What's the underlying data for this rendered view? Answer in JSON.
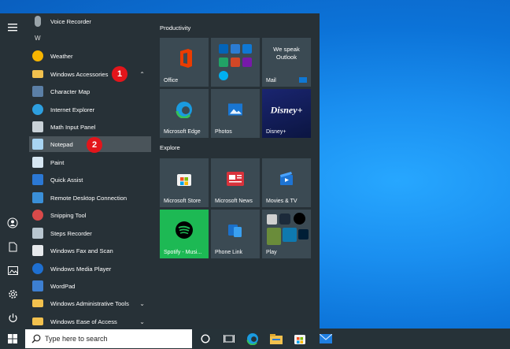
{
  "app_list": {
    "section_letter": "W",
    "items": [
      {
        "label": "Voice Recorder",
        "icon": "microphone-icon"
      },
      {
        "label": "Weather",
        "icon": "weather-icon"
      },
      {
        "label": "Windows Accessories",
        "icon": "folder-icon"
      },
      {
        "label": "Character Map",
        "icon": "character-map-icon"
      },
      {
        "label": "Internet Explorer",
        "icon": "internet-explorer-icon"
      },
      {
        "label": "Math Input Panel",
        "icon": "math-input-icon"
      },
      {
        "label": "Notepad",
        "icon": "notepad-icon"
      },
      {
        "label": "Paint",
        "icon": "paint-icon"
      },
      {
        "label": "Quick Assist",
        "icon": "quick-assist-icon"
      },
      {
        "label": "Remote Desktop Connection",
        "icon": "remote-desktop-icon"
      },
      {
        "label": "Snipping Tool",
        "icon": "snipping-tool-icon"
      },
      {
        "label": "Steps Recorder",
        "icon": "steps-recorder-icon"
      },
      {
        "label": "Windows Fax and Scan",
        "icon": "fax-scan-icon"
      },
      {
        "label": "Windows Media Player",
        "icon": "media-player-icon"
      },
      {
        "label": "WordPad",
        "icon": "wordpad-icon"
      },
      {
        "label": "Windows Administrative Tools",
        "icon": "folder-icon"
      },
      {
        "label": "Windows Ease of Access",
        "icon": "folder-icon"
      }
    ]
  },
  "badges": {
    "first": "1",
    "second": "2"
  },
  "tiles": {
    "productivity_header": "Productivity",
    "explore_header": "Explore",
    "office": "Office",
    "mail_promo": "We speak Outlook",
    "mail": "Mail",
    "edge": "Microsoft Edge",
    "photos": "Photos",
    "disney_logo": "Disney+",
    "disney": "Disney+",
    "store": "Microsoft Store",
    "news": "Microsoft News",
    "movies": "Movies & TV",
    "spotify": "Spotify - Musi...",
    "phone_link": "Phone Link",
    "play": "Play"
  },
  "taskbar": {
    "search_placeholder": "Type here to search"
  },
  "colors": {
    "start_bg": "#273137",
    "accent_badge": "#e3151b",
    "spotify_green": "#1db954"
  }
}
